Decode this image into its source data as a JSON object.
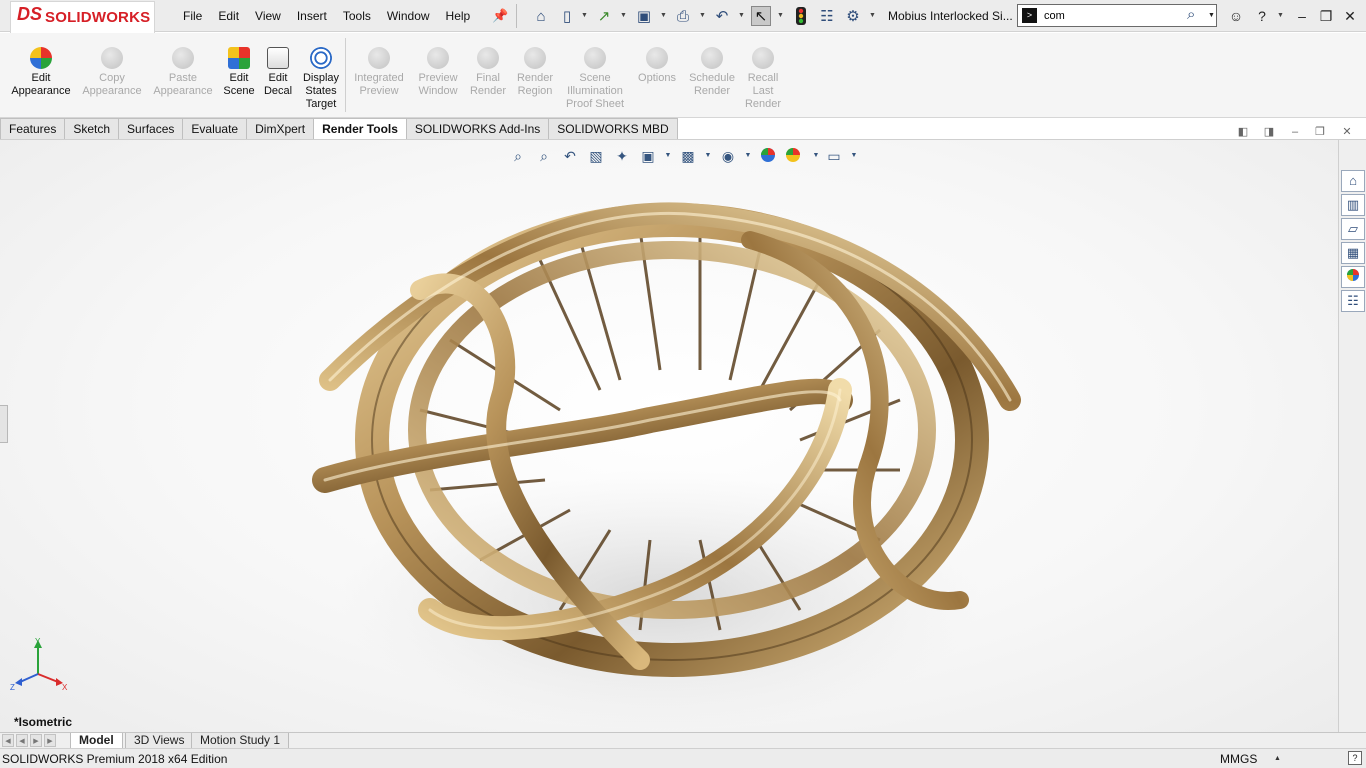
{
  "app": {
    "logo_mark": "DS",
    "logo_text": "SOLIDWORKS",
    "document_title": "Mobius Interlocked Si..."
  },
  "menu": [
    "File",
    "Edit",
    "View",
    "Insert",
    "Tools",
    "Window",
    "Help"
  ],
  "quick_access_icons": [
    "home-icon",
    "new-document-icon",
    "open-icon",
    "save-icon",
    "print-icon",
    "undo-icon",
    "select-icon",
    "rebuild-icon",
    "file-properties-icon",
    "options-icon"
  ],
  "search": {
    "value": "com",
    "prefix_glyph": ">"
  },
  "window_controls": [
    "user-icon",
    "help-icon",
    "minimize-icon",
    "restore-icon",
    "close-icon"
  ],
  "ribbon": {
    "enabled": [
      {
        "label": "Edit Appearance"
      },
      {
        "label": "Copy Appearance"
      },
      {
        "label": "Paste Appearance"
      },
      {
        "label": "Edit Scene"
      },
      {
        "label": "Edit Decal"
      },
      {
        "label": "Display States Target"
      }
    ],
    "disabled": [
      {
        "label": "Integrated Preview"
      },
      {
        "label": "Preview Window"
      },
      {
        "label": "Final Render"
      },
      {
        "label": "Render Region"
      },
      {
        "label": "Scene Illumination Proof Sheet"
      },
      {
        "label": "Options"
      },
      {
        "label": "Schedule Render"
      },
      {
        "label": "Recall Last Render"
      }
    ]
  },
  "tabs": [
    {
      "label": "Features",
      "active": false
    },
    {
      "label": "Sketch",
      "active": false
    },
    {
      "label": "Surfaces",
      "active": false
    },
    {
      "label": "Evaluate",
      "active": false
    },
    {
      "label": "DimXpert",
      "active": false
    },
    {
      "label": "Render Tools",
      "active": true
    },
    {
      "label": "SOLIDWORKS Add-Ins",
      "active": false
    },
    {
      "label": "SOLIDWORKS MBD",
      "active": false
    }
  ],
  "viewport": {
    "view_name": "*Isometric",
    "model_color": "#a88750",
    "triad": {
      "x": "X",
      "y": "Y",
      "z": "Z"
    }
  },
  "bottom_tabs": [
    {
      "label": "Model",
      "active": true
    },
    {
      "label": "3D Views",
      "active": false
    },
    {
      "label": "Motion Study 1",
      "active": false
    }
  ],
  "status": {
    "edition": "SOLIDWORKS Premium 2018 x64 Edition",
    "units": "MMGS"
  }
}
